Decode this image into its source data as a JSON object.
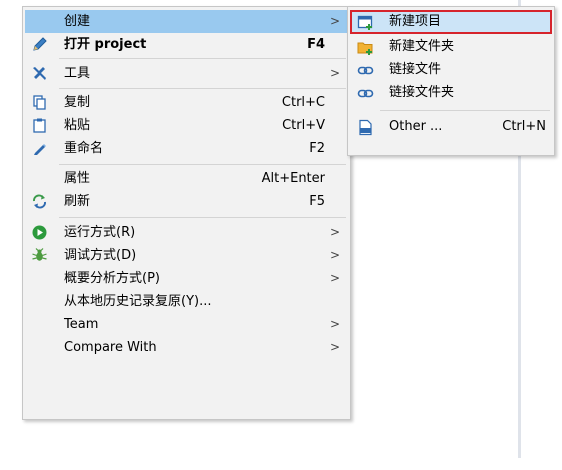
{
  "main_menu": {
    "create": {
      "label": "创建",
      "arrow": ">"
    },
    "open_project": {
      "label": "打开 project",
      "shortcut": "F4"
    },
    "tools": {
      "label": "工具",
      "arrow": ">"
    },
    "copy": {
      "label": "复制",
      "shortcut": "Ctrl+C"
    },
    "paste": {
      "label": "粘贴",
      "shortcut": "Ctrl+V"
    },
    "rename": {
      "label": "重命名",
      "shortcut": "F2"
    },
    "properties": {
      "label": "属性",
      "shortcut": "Alt+Enter"
    },
    "refresh": {
      "label": "刷新",
      "shortcut": "F5"
    },
    "run_as": {
      "label": "运行方式(R)",
      "arrow": ">"
    },
    "debug_as": {
      "label": "调试方式(D)",
      "arrow": ">"
    },
    "profile_as": {
      "label": "概要分析方式(P)",
      "arrow": ">"
    },
    "restore_history": {
      "label": "从本地历史记录复原(Y)..."
    },
    "team": {
      "label": "Team",
      "arrow": ">"
    },
    "compare_with": {
      "label": "Compare With",
      "arrow": ">"
    }
  },
  "sub_menu": {
    "new_project": {
      "label": "新建项目"
    },
    "new_folder": {
      "label": "新建文件夹"
    },
    "link_file": {
      "label": "链接文件"
    },
    "link_folder": {
      "label": "链接文件夹"
    },
    "other": {
      "label": "Other ...",
      "shortcut": "Ctrl+N"
    }
  },
  "icons": {
    "open_project": "pencil-icon",
    "tools": "tools-icon",
    "copy": "copy-icon",
    "paste": "clipboard-icon",
    "rename": "rename-icon",
    "refresh": "refresh-icon",
    "run_as": "run-icon",
    "debug_as": "bug-icon",
    "new_project": "new-project-icon",
    "new_folder": "new-folder-icon",
    "link_file": "link-icon",
    "link_folder": "link-icon",
    "other": "object-file-icon"
  },
  "colors": {
    "menu_bg": "#f2f2f2",
    "highlight_main": "#99c9ef",
    "highlight_sub": "#cce4f7",
    "highlight_border": "#d6242c"
  }
}
